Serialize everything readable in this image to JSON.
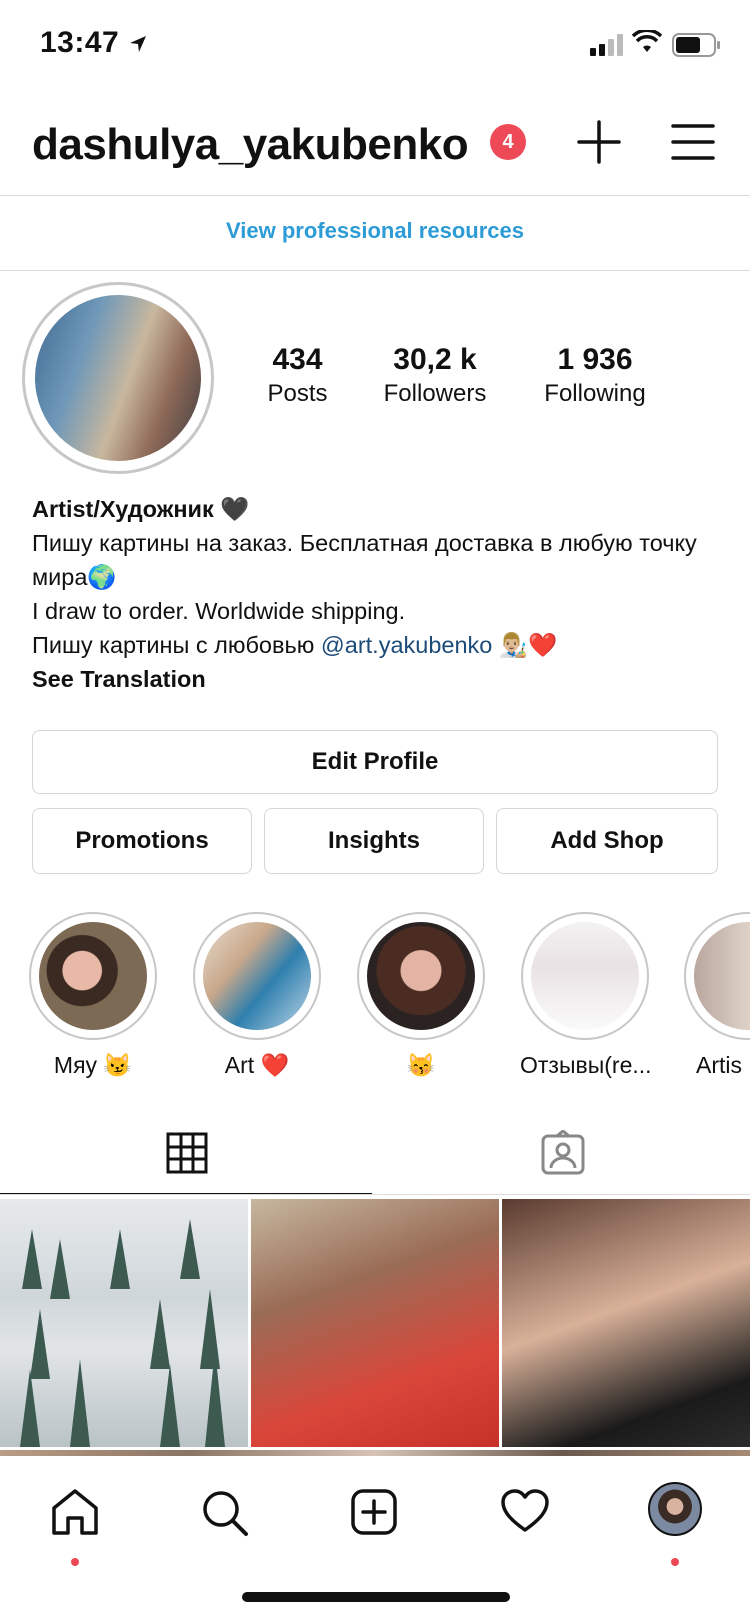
{
  "status_bar": {
    "time": "13:47"
  },
  "header": {
    "username": "dashulya_yakubenko",
    "notification_count": "4"
  },
  "professional_link": "View professional resources",
  "stats": {
    "posts": {
      "value": "434",
      "label": "Posts"
    },
    "followers": {
      "value": "30,2 k",
      "label": "Followers"
    },
    "following": {
      "value": "1 936",
      "label": "Following"
    }
  },
  "bio": {
    "name": "Artist/Художник 🖤",
    "line1": "Пишу картины на заказ. Бесплатная доставка в любую точку мира🌍",
    "line2": "I draw to order. Worldwide shipping.",
    "line3_prefix": "Пишу картины с любовью ",
    "mention": "@art.yakubenko",
    "line3_suffix": " 👨🏼‍🎨❤️",
    "see_translation": "See Translation"
  },
  "buttons": {
    "edit_profile": "Edit Profile",
    "promotions": "Promotions",
    "insights": "Insights",
    "add_shop": "Add Shop"
  },
  "highlights": [
    {
      "label": "Мяу 😼"
    },
    {
      "label": "Art ❤️"
    },
    {
      "label": "😽"
    },
    {
      "label": "Отзывы(re..."
    },
    {
      "label": "Artis"
    }
  ],
  "icons": {
    "grid_tab": "grid-icon",
    "tagged_tab": "tagged-icon",
    "nav": [
      "home-icon",
      "search-icon",
      "add-post-icon",
      "activity-heart-icon",
      "profile-avatar"
    ]
  },
  "colors": {
    "accent_link": "#2d9bd6",
    "notification": "#ed4956",
    "mention": "#1c4b7a"
  }
}
